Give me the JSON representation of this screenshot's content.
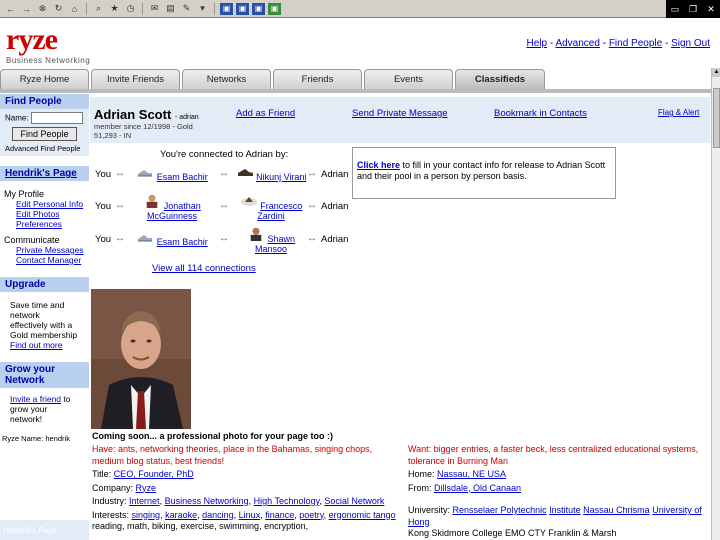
{
  "browser": {
    "toolbar_icons": [
      "back-icon",
      "forward-icon",
      "stop-icon",
      "refresh-icon",
      "home-icon",
      "search-icon",
      "favorites-icon",
      "history-icon",
      "mail-icon",
      "print-icon",
      "edit-icon",
      "discuss-icon"
    ],
    "window_controls": [
      "monitor-icon",
      "restore-icon",
      "close-icon"
    ]
  },
  "header": {
    "logo": "ryze",
    "tagline": "Business Networking",
    "links": [
      "Help",
      "Advanced",
      "Find People",
      "Sign Out"
    ],
    "separator": " - "
  },
  "tabs": [
    "Ryze Home",
    "Invite Friends",
    "Networks",
    "Friends",
    "Events",
    "Classifieds"
  ],
  "sidebar": {
    "find_people": {
      "header": "Find People",
      "name_label": "Name:",
      "button": "Find People",
      "advanced": "Advanced Find People"
    },
    "my_page": {
      "header": "Hendrik's Page",
      "profile_title": "My Profile",
      "profile_links": [
        "Edit Personal Info",
        "Edit Photos",
        "Preferences"
      ],
      "communicate_title": "Communicate",
      "communicate_links": [
        "Private Messages",
        "Contact Manager"
      ]
    },
    "upgrade": {
      "header": "Upgrade",
      "text_lines": [
        "Save time and",
        "network",
        "effectively with a",
        "Gold membership"
      ],
      "link": "Find out more"
    },
    "grow": {
      "header": "Grow your Network",
      "link": "Invite a friend",
      "text_lines": [
        "to",
        "grow your",
        "network!"
      ]
    },
    "footer": "Ryze Name: hendrik",
    "bottom": "Hendrik's Page"
  },
  "profile": {
    "name": "Adrian Scott",
    "name_suffix": "- adrian",
    "member_since": "member since 12/1998 - Gold",
    "count": "51,293 - IN",
    "actions": [
      "Add as Friend",
      "Send Private Message",
      "Bookmark in Contacts",
      "Flag & Alert"
    ]
  },
  "connections": {
    "title": "You're connected to Adrian by:",
    "you": "You",
    "adrian": "Adrian",
    "arrow": "↔",
    "rows": [
      {
        "first": "Esam Bachir",
        "second": "Nikunj Virani"
      },
      {
        "first": "Jonathan McGuinness",
        "second": "Francesco Zardini"
      },
      {
        "first": "Esam Bachir",
        "second": "Shawn Mansoo"
      }
    ],
    "view_all": "View all 114 connections"
  },
  "info_box": {
    "link": "Click here",
    "text": " to fill in your contact info for release to Adrian Scott and their pool in a person by person basis."
  },
  "about": {
    "coming_soon": "Coming soon... a professional photo for your page too :)",
    "have": "Have: ants, networking theories, place in the Bahamas, singing chops, medium blog status, best friends!",
    "title_label": "Title:",
    "title_value": "CEO, Founder, PhD",
    "company_label": "Company:",
    "company_value": "Ryze",
    "industry_label": "Industry:",
    "industry_values": [
      "Internet",
      "Business Networking",
      "High Technology",
      "Social Network"
    ],
    "interests_label": "Interests:",
    "interests_links": [
      "singing",
      "karaoke",
      "dancing",
      "Linux",
      "finance",
      "poetry",
      "ergonomic tango"
    ],
    "interests_text": "reading, math, biking, exercise, swimming, encryption,",
    "want": "Want: bigger entries, a faster beck, less centralized educational systems, tolerance in Burning Man",
    "home_label": "Home:",
    "home_value": "Nassau, NE USA",
    "from_label": "From:",
    "from_value": "Dillsdale, Old Canaan",
    "univ_label": "University:",
    "univ_links": [
      "Rensselaer Polytechnic",
      "Institute",
      "Nassau Chrisma",
      "University of Hong"
    ],
    "univ_text": "Kong Skidmore College EMO CTY Franklin & Marsh"
  },
  "colors": {
    "brand_red": "#cc0000",
    "sidebar_blue": "#b9d0ee",
    "panel_blue": "#e3ebf6",
    "link_blue": "#0000cc"
  }
}
